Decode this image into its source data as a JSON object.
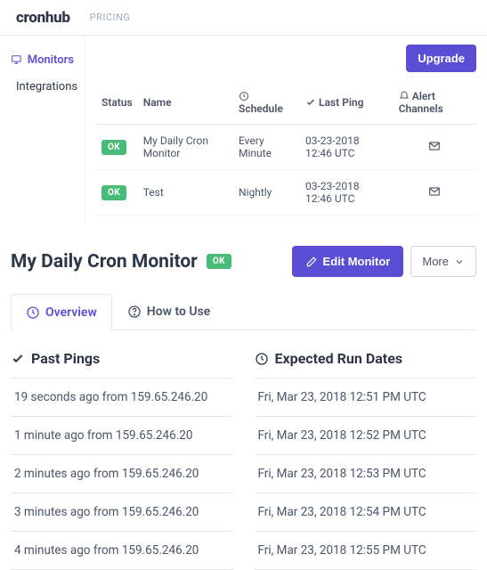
{
  "topbar": {
    "logo": "cronhub",
    "pricing": "PRICING"
  },
  "sidebar": {
    "monitors": "Monitors",
    "integrations": "Integrations"
  },
  "upgrade": "Upgrade",
  "table": {
    "headers": {
      "status": "Status",
      "name": "Name",
      "schedule": "Schedule",
      "lastPing": "Last Ping",
      "alertChannels": "Alert Channels"
    },
    "rows": [
      {
        "status": "OK",
        "name": "My Daily Cron Monitor",
        "schedule": "Every Minute",
        "lastPing": "03-23-2018 12:46 UTC"
      },
      {
        "status": "OK",
        "name": "Test",
        "schedule": "Nightly",
        "lastPing": "03-23-2018 12:46 UTC"
      }
    ]
  },
  "detail": {
    "title": "My Daily Cron Monitor",
    "badge": "OK",
    "edit": "Edit Monitor",
    "more": "More",
    "tabs": {
      "overview": "Overview",
      "howto": "How to Use"
    },
    "pastPingsTitle": "Past Pings",
    "expectedTitle": "Expected Run Dates",
    "pastPings": [
      "19 seconds ago from 159.65.246.20",
      "1 minute ago from 159.65.246.20",
      "2 minutes ago from 159.65.246.20",
      "3 minutes ago from 159.65.246.20",
      "4 minutes ago from 159.65.246.20"
    ],
    "expected": [
      "Fri, Mar 23, 2018 12:51 PM UTC",
      "Fri, Mar 23, 2018 12:52 PM UTC",
      "Fri, Mar 23, 2018 12:53 PM UTC",
      "Fri, Mar 23, 2018 12:54 PM UTC",
      "Fri, Mar 23, 2018 12:55 PM UTC"
    ]
  }
}
